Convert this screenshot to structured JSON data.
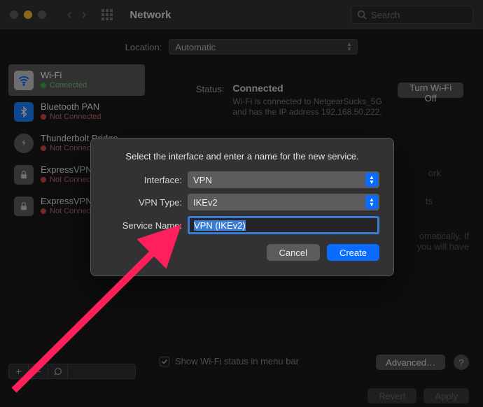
{
  "window": {
    "title": "Network",
    "search_placeholder": "Search"
  },
  "location": {
    "label": "Location:",
    "value": "Automatic"
  },
  "sidebar": {
    "items": [
      {
        "name": "Wi-Fi",
        "status": "Connected",
        "state": "connected"
      },
      {
        "name": "Bluetooth PAN",
        "status": "Not Connected",
        "state": "disconnected"
      },
      {
        "name": "Thunderbolt Bridge",
        "status": "Not Connected",
        "state": "disconnected"
      },
      {
        "name": "ExpressVPN",
        "status": "Not Connected",
        "state": "disconnected"
      },
      {
        "name": "ExpressVPN",
        "status": "Not Connected",
        "state": "disconnected"
      }
    ]
  },
  "status_panel": {
    "label": "Status:",
    "value": "Connected",
    "toggle_label": "Turn Wi-Fi Off",
    "description": "Wi-Fi is connected to NetgearSucks_5G and has the IP address 192.168.50.222."
  },
  "ghost_texts": {
    "network_name": "ork",
    "hotspots": "ts",
    "auto_lines": "omatically. If\nyou will have"
  },
  "menubar_checkbox": {
    "label": "Show Wi-Fi status in menu bar",
    "checked": true
  },
  "buttons": {
    "advanced": "Advanced…",
    "help": "?",
    "revert": "Revert",
    "apply": "Apply"
  },
  "modal": {
    "prompt": "Select the interface and enter a name for the new service.",
    "rows": {
      "interface_label": "Interface:",
      "interface_value": "VPN",
      "vpn_type_label": "VPN Type:",
      "vpn_type_value": "IKEv2",
      "service_name_label": "Service Name:",
      "service_name_value": "VPN (IKEv2)"
    },
    "cancel": "Cancel",
    "create": "Create"
  },
  "annotation": {
    "color": "#ff1f5a"
  }
}
